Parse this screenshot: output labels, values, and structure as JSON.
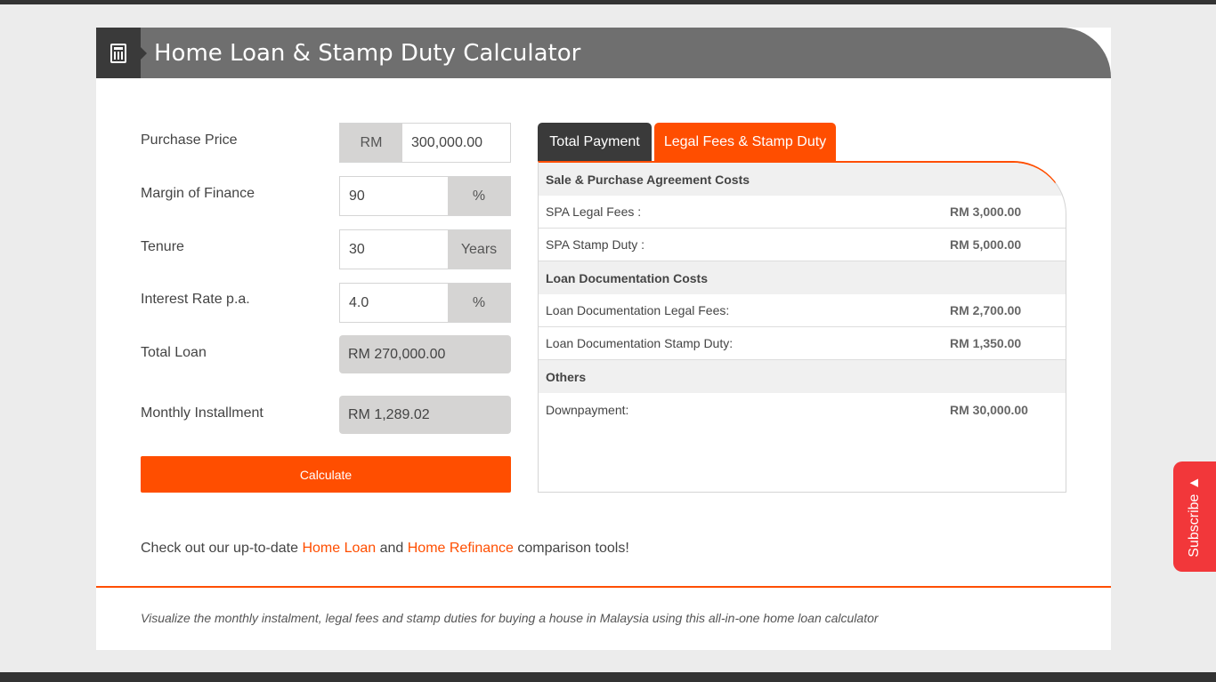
{
  "header": {
    "title": "Home Loan & Stamp Duty Calculator",
    "icon": "calculator-icon"
  },
  "form": {
    "purchase_price": {
      "label": "Purchase Price",
      "prefix": "RM",
      "value": "300,000.00"
    },
    "margin": {
      "label": "Margin of Finance",
      "value": "90",
      "suffix": "%"
    },
    "tenure": {
      "label": "Tenure",
      "value": "30",
      "suffix": "Years"
    },
    "interest": {
      "label": "Interest Rate p.a.",
      "value": "4.0",
      "suffix": "%"
    },
    "total_loan": {
      "label": "Total Loan",
      "value": "RM 270,000.00"
    },
    "monthly": {
      "label": "Monthly Installment",
      "value": "RM 1,289.02"
    },
    "calculate": "Calculate"
  },
  "tabs": [
    {
      "label": "Total Payment",
      "active": false
    },
    {
      "label": "Legal Fees & Stamp Duty",
      "active": true
    }
  ],
  "fees": {
    "spa_title": "Sale & Purchase Agreement Costs",
    "spa_legal": {
      "label": "SPA Legal Fees :",
      "value": "RM 3,000.00"
    },
    "spa_stamp": {
      "label": "SPA Stamp Duty :",
      "value": "RM 5,000.00"
    },
    "loan_title": "Loan Documentation Costs",
    "loan_legal": {
      "label": "Loan Documentation Legal Fees:",
      "value": "RM 2,700.00"
    },
    "loan_stamp": {
      "label": "Loan Documentation Stamp Duty:",
      "value": "RM 1,350.00"
    },
    "others_title": "Others",
    "down": {
      "label": "Downpayment:",
      "value": "RM 30,000.00"
    }
  },
  "promo": {
    "pre": "Check out our up-to-date ",
    "link1": "Home Loan",
    "mid": " and ",
    "link2": "Home Refinance",
    "post": " comparison tools!"
  },
  "footer": "Visualize the monthly instalment, legal fees and stamp duties for buying a house in Malaysia using this all-in-one home loan calculator",
  "subscribe": "Subscribe ▲",
  "colors": {
    "accent": "#ff4e00",
    "header": "#6f6f6f",
    "dark": "#3a3a3a",
    "subscribe": "#f2373a"
  }
}
